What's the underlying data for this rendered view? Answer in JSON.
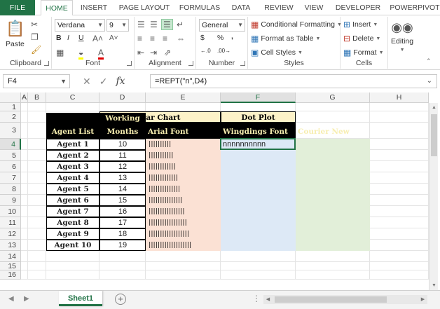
{
  "tabs": [
    "FILE",
    "HOME",
    "INSERT",
    "PAGE LAYOUT",
    "FORMULAS",
    "DATA",
    "REVIEW",
    "VIEW",
    "DEVELOPER",
    "POWERPIVOT"
  ],
  "ribbon": {
    "clipboard": {
      "label": "Clipboard",
      "paste": "Paste"
    },
    "font": {
      "label": "Font",
      "name": "Verdana",
      "size": "9",
      "bold": "B",
      "italic": "I",
      "underline": "U"
    },
    "alignment": {
      "label": "Alignment"
    },
    "number": {
      "label": "Number",
      "format": "General",
      "currency": "$",
      "percent": "%",
      "comma": ","
    },
    "styles": {
      "label": "Styles",
      "conditional": "Conditional Formatting",
      "format_table": "Format as Table",
      "cell_styles": "Cell Styles"
    },
    "cells": {
      "label": "Cells",
      "insert": "Insert",
      "delete": "Delete",
      "format": "Format"
    },
    "editing": {
      "label": "Editing"
    }
  },
  "formula_bar": {
    "name_box": "F4",
    "formula": "=REPT(\"n\",D4)"
  },
  "columns": [
    "A",
    "B",
    "C",
    "D",
    "E",
    "F",
    "G",
    "H"
  ],
  "rows": [
    "1",
    "2",
    "3",
    "4",
    "5",
    "6",
    "7",
    "8",
    "9",
    "10",
    "11",
    "12",
    "13",
    "14",
    "15",
    "16"
  ],
  "table": {
    "band_bar_chart": "Bar Chart",
    "band_dot_plot": "Dot Plot",
    "header_agent": "Agent List",
    "header_months_1": "Working",
    "header_months_2": "Months",
    "header_arial": "Arial Font",
    "header_wingdings": "Wingdings Font",
    "header_courier": "Courier New",
    "agents": [
      "Agent 1",
      "Agent 2",
      "Agent 3",
      "Agent 4",
      "Agent 5",
      "Agent 6",
      "Agent 7",
      "Agent 8",
      "Agent 9",
      "Agent 10"
    ],
    "months": [
      "10",
      "11",
      "12",
      "13",
      "14",
      "15",
      "16",
      "17",
      "18",
      "19"
    ],
    "bars": [
      "||||||||||",
      "|||||||||||",
      "||||||||||||",
      "|||||||||||||",
      "||||||||||||||",
      "|||||||||||||||",
      "||||||||||||||||",
      "|||||||||||||||||",
      "||||||||||||||||||",
      "|||||||||||||||||||"
    ],
    "wingdings_f4": "nnnnnnnnnn"
  },
  "sheet_tab": "Sheet1",
  "add_sheet": "+",
  "editing_icon": "binoculars-icon"
}
